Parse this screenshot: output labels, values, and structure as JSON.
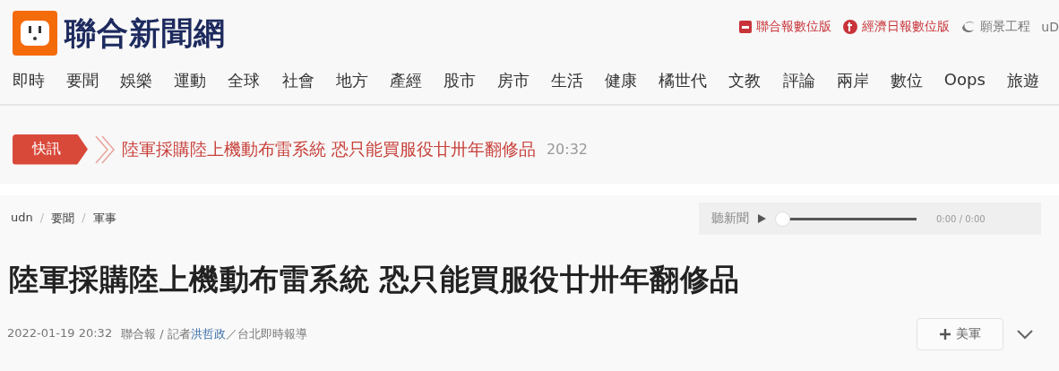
{
  "header": {
    "site_title": "聯合新聞網",
    "links": [
      {
        "label": "聯合報數位版",
        "kind": "square"
      },
      {
        "label": "經濟日報數位版",
        "kind": "circle"
      },
      {
        "label": "願景工程",
        "kind": "swirl"
      },
      {
        "label": "uD",
        "kind": "plain"
      }
    ]
  },
  "nav": [
    "即時",
    "要聞",
    "娛樂",
    "運動",
    "全球",
    "社會",
    "地方",
    "產經",
    "股市",
    "房市",
    "生活",
    "健康",
    "橘世代",
    "文教",
    "評論",
    "兩岸",
    "數位",
    "Oops",
    "旅遊"
  ],
  "ticker": {
    "badge": "快訊",
    "headline": "陸軍採購陸上機動布雷系統 恐只能買服役廿卅年翻修品",
    "time": "20:32"
  },
  "breadcrumb": {
    "separator": "/",
    "items": [
      "udn",
      "要聞",
      "軍事"
    ]
  },
  "audio": {
    "label": "聽新聞",
    "level": 0,
    "time": "0:00 / 0:00"
  },
  "article": {
    "title": "陸軍採購陸上機動布雷系統 恐只能買服役廿卅年翻修品",
    "date": "2022-01-19 20:32",
    "byline_prefix": "聯合報 / 記者",
    "author": "洪哲政",
    "byline_suffix": "／台北即時報導",
    "follow": "美軍"
  }
}
